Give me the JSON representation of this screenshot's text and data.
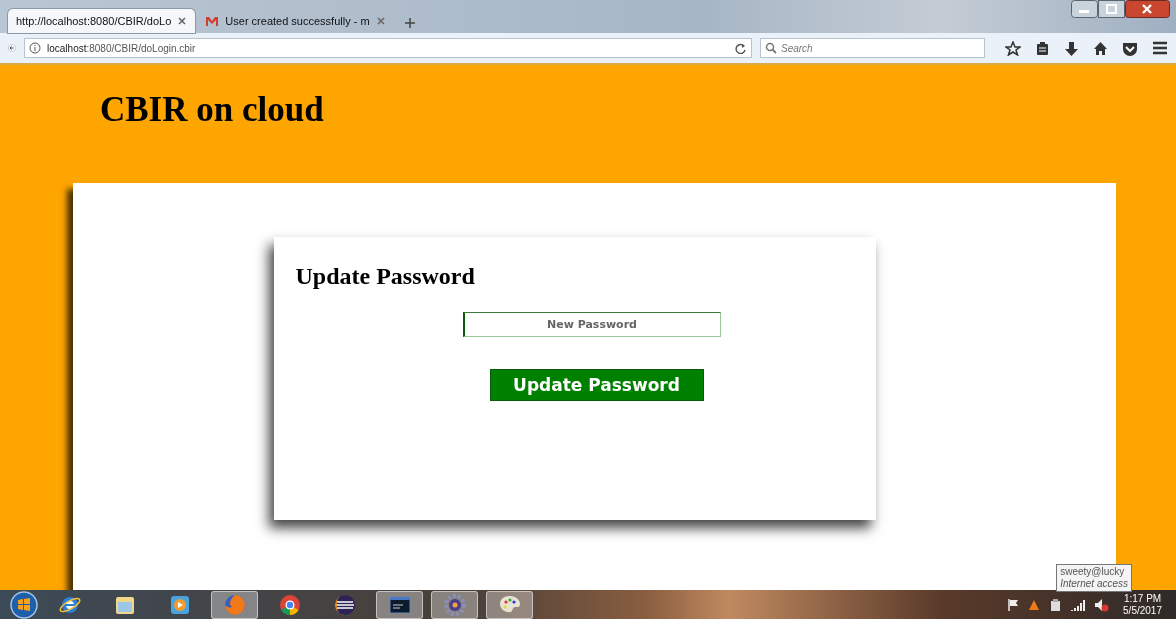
{
  "browser": {
    "tabs": [
      {
        "title": "http://localhost:8080/CBIR/doLo",
        "kind": "page",
        "selected": true
      },
      {
        "title": "User created successfully - m",
        "kind": "mail",
        "selected": false
      }
    ],
    "address": {
      "host": "localhost",
      "path": ":8080/CBIR/doLogin.cbir"
    },
    "search": {
      "placeholder": "Search"
    }
  },
  "page": {
    "title": "CBIR on cloud",
    "card": {
      "heading": "Update Password",
      "field": {
        "placeholder": "New Password"
      },
      "button": "Update Password"
    }
  },
  "taskbar": {
    "apps": [
      {
        "kind": "ie",
        "active": false
      },
      {
        "kind": "folder",
        "active": false
      },
      {
        "kind": "media",
        "active": false
      },
      {
        "kind": "firefox",
        "active": true
      },
      {
        "kind": "chrome",
        "active": false
      },
      {
        "kind": "eclipse",
        "active": false
      },
      {
        "kind": "terminal",
        "active": true
      },
      {
        "kind": "gear",
        "active": true
      },
      {
        "kind": "paint",
        "active": true
      }
    ],
    "tooltip": {
      "title": "sweety@lucky",
      "subtitle": "Internet access"
    },
    "time": "1:17 PM",
    "date": "5/5/2017"
  }
}
